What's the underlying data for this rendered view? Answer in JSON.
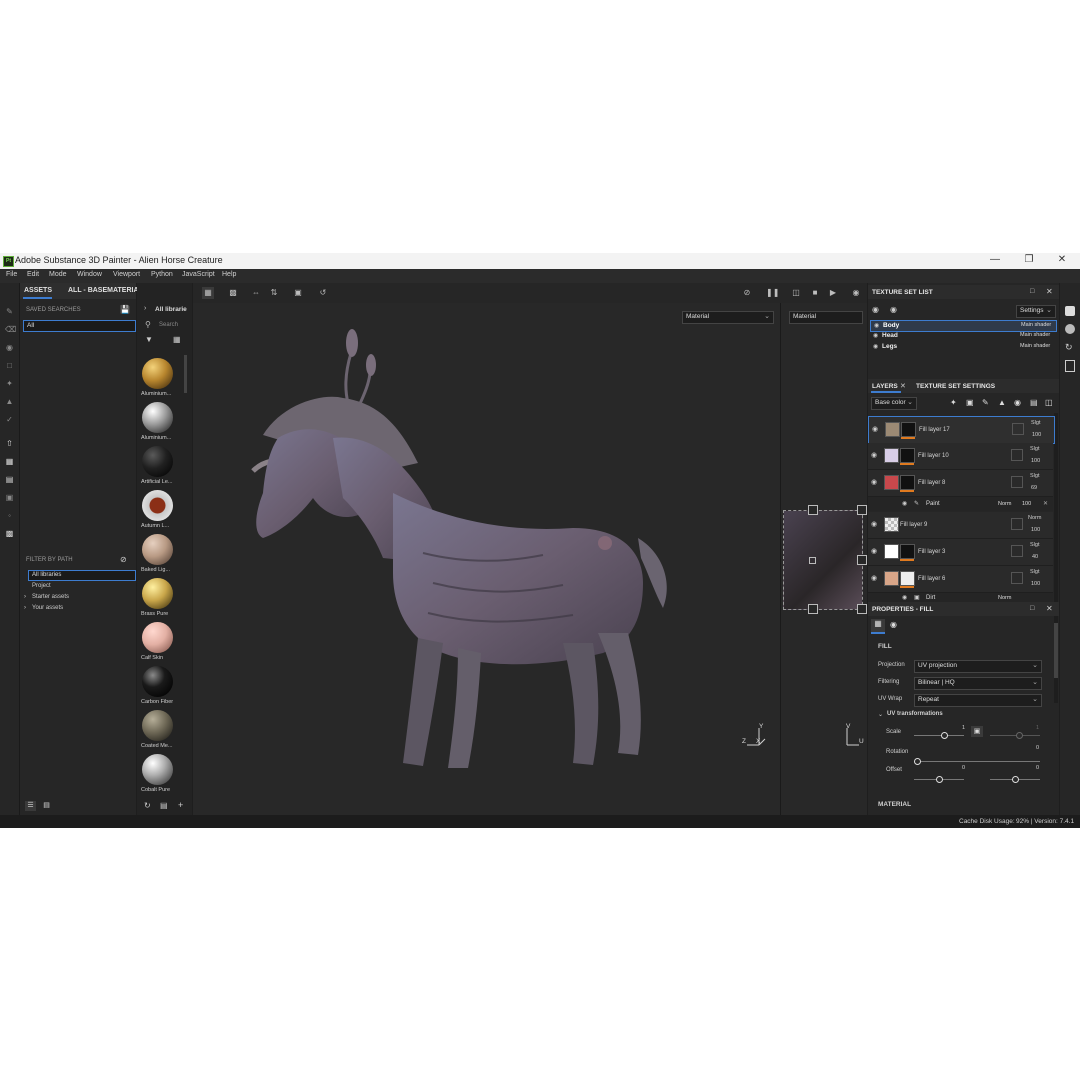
{
  "app": {
    "title": "Adobe Substance 3D Painter - Alien Horse Creature",
    "icon_text": "Pt"
  },
  "menu": [
    "File",
    "Edit",
    "Mode",
    "Window",
    "Viewport",
    "Python",
    "JavaScript",
    "Help"
  ],
  "assets": {
    "tab_assets": "ASSETS",
    "tab_all": "ALL - BASEMATERIAL",
    "saved_searches": "SAVED SEARCHES",
    "search_value": "All",
    "filter_by_path": "FILTER BY PATH",
    "paths": [
      "All libraries",
      "Project",
      "Starter assets",
      "Your assets"
    ]
  },
  "materials": {
    "header": "All librarie",
    "search_placeholder": "Search",
    "items": [
      {
        "label": "Aluminium...",
        "color": "#b8862e"
      },
      {
        "label": "Aluminium...",
        "color": "#9a9a9a"
      },
      {
        "label": "Artificial Le...",
        "color": "#202020"
      },
      {
        "label": "Autumn L...",
        "color": "#c8c8c8"
      },
      {
        "label": "Baked Lig...",
        "color": "#b89a84"
      },
      {
        "label": "Brass Pure",
        "color": "#c9a64a"
      },
      {
        "label": "Calf Skin",
        "color": "#e3b0a4"
      },
      {
        "label": "Carbon Fiber",
        "color": "#1a1a1a"
      },
      {
        "label": "Coated Me...",
        "color": "#6e6856"
      },
      {
        "label": "Cobalt Pure",
        "color": "#b0b0b0"
      }
    ]
  },
  "viewport": {
    "dropdown_left": "Material",
    "dropdown_right": "Material",
    "axis_3d": {
      "z": "Z",
      "x": "X",
      "y": "Y"
    },
    "axis_uv": {
      "v": "V",
      "u": "U"
    }
  },
  "texture_set_list": {
    "title": "TEXTURE SET LIST",
    "settings": "Settings",
    "sets": [
      {
        "name": "Body",
        "shader": "Main shader"
      },
      {
        "name": "Head",
        "shader": "Main shader"
      },
      {
        "name": "Legs",
        "shader": "Main shader"
      }
    ]
  },
  "layers": {
    "tab_layers": "LAYERS",
    "tab_tss": "TEXTURE SET SETTINGS",
    "channel": "Base color",
    "items": [
      {
        "name": "Fill layer 17",
        "blend": "Slgt",
        "opacity": "100",
        "thumb": "#9c8a74"
      },
      {
        "name": "Fill layer 10",
        "blend": "Slgt",
        "opacity": "100",
        "thumb": "#d8cde6"
      },
      {
        "name": "Fill layer 8",
        "blend": "Slgt",
        "opacity": "69",
        "thumb": "#c8484c"
      },
      {
        "name": "Fill layer 9",
        "blend": "Norm",
        "opacity": "100",
        "thumb": "#cfcfcf"
      },
      {
        "name": "Fill layer 3",
        "blend": "Slgt",
        "opacity": "40",
        "thumb": "#ffffff"
      },
      {
        "name": "Fill layer 6",
        "blend": "Slgt",
        "opacity": "100",
        "thumb": "#d8a588"
      }
    ],
    "sub_paint": {
      "name": "Paint",
      "blend": "Norm",
      "opacity": "100"
    },
    "sub_dirt": {
      "name": "Dirt",
      "blend": "Norm"
    }
  },
  "properties": {
    "title": "PROPERTIES - FILL",
    "section": "FILL",
    "projection_label": "Projection",
    "projection_value": "UV projection",
    "filtering_label": "Filtering",
    "filtering_value": "Bilinear | HQ",
    "uvwrap_label": "UV Wrap",
    "uvwrap_value": "Repeat",
    "uvt_header": "UV transformations",
    "scale_label": "Scale",
    "scale_value": "1",
    "scale_value2": "1",
    "rotation_label": "Rotation",
    "rotation_value": "0",
    "offset_label": "Offset",
    "offset_value1": "0",
    "offset_value2": "0",
    "material_header": "MATERIAL"
  },
  "status": {
    "cache": "Cache Disk Usage:",
    "usage": "92% | Version: 7.4.1"
  },
  "colors": {
    "accent_blue": "#3d7ccf",
    "layer_orange": "#e07a1f",
    "panel_bg": "#262626"
  }
}
